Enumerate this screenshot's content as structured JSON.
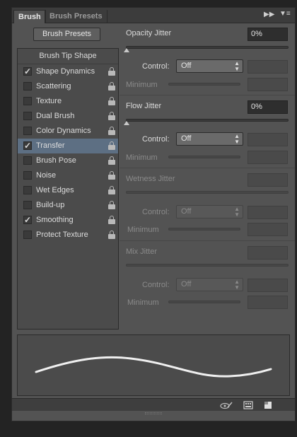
{
  "tabs": {
    "brush": "Brush",
    "brush_presets": "Brush Presets"
  },
  "presets_button": "Brush Presets",
  "list": {
    "header": "Brush Tip Shape",
    "items": [
      {
        "label": "Shape Dynamics",
        "checked": true,
        "selected": false
      },
      {
        "label": "Scattering",
        "checked": false,
        "selected": false
      },
      {
        "label": "Texture",
        "checked": false,
        "selected": false
      },
      {
        "label": "Dual Brush",
        "checked": false,
        "selected": false
      },
      {
        "label": "Color Dynamics",
        "checked": false,
        "selected": false
      },
      {
        "label": "Transfer",
        "checked": true,
        "selected": true
      },
      {
        "label": "Brush Pose",
        "checked": false,
        "selected": false
      },
      {
        "label": "Noise",
        "checked": false,
        "selected": false
      },
      {
        "label": "Wet Edges",
        "checked": false,
        "selected": false
      },
      {
        "label": "Build-up",
        "checked": false,
        "selected": false
      },
      {
        "label": "Smoothing",
        "checked": true,
        "selected": false
      },
      {
        "label": "Protect Texture",
        "checked": false,
        "selected": false
      }
    ]
  },
  "opacity": {
    "label": "Opacity Jitter",
    "value": "0%",
    "control_label": "Control:",
    "control_value": "Off",
    "minimum_label": "Minimum"
  },
  "flow": {
    "label": "Flow Jitter",
    "value": "0%",
    "control_label": "Control:",
    "control_value": "Off",
    "minimum_label": "Minimum"
  },
  "wetness": {
    "label": "Wetness Jitter",
    "control_label": "Control:",
    "control_value": "Off",
    "minimum_label": "Minimum"
  },
  "mix": {
    "label": "Mix Jitter",
    "control_label": "Control:",
    "control_value": "Off",
    "minimum_label": "Minimum"
  },
  "icons": {
    "tab_collapse": "double-chevron-right-icon",
    "panel_menu": "panel-menu-icon",
    "toggle_preview": "eye-brush-icon",
    "brush_grid": "brush-grid-icon",
    "new_preset": "new-preset-icon",
    "lock": "lock-icon"
  },
  "colors": {
    "selection": "#5d6f83",
    "panel": "#535353"
  }
}
